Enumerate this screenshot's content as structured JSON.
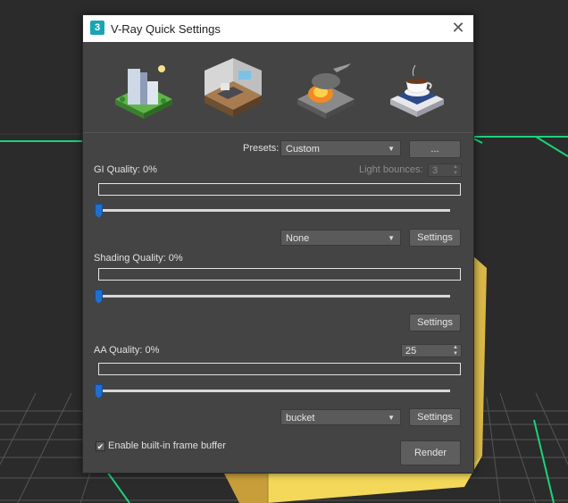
{
  "window": {
    "title": "V-Ray Quick Settings",
    "app_icon_label": "3",
    "close_glyph": "✕"
  },
  "presets_row": {
    "icons": [
      "exterior-preset-icon",
      "interior-preset-icon",
      "fx-preset-icon",
      "product-preset-icon"
    ],
    "label": "Presets:",
    "selected": "Custom",
    "more_label": "..."
  },
  "gi": {
    "label": "GI Quality: 0%",
    "value_percent": 0,
    "light_bounces_label": "Light bounces:",
    "light_bounces_value": "3",
    "engine_selected": "None",
    "settings_label": "Settings"
  },
  "shading": {
    "label": "Shading Quality: 0%",
    "value_percent": 0,
    "settings_label": "Settings"
  },
  "aa": {
    "label": "AA Quality: 0%",
    "value_percent": 0,
    "spinner_value": "25",
    "sampler_selected": "bucket",
    "settings_label": "Settings"
  },
  "footer": {
    "vfb_checkbox_checked": true,
    "vfb_checkbox_glyph": "✔",
    "vfb_label": "Enable built-in frame buffer",
    "render_label": "Render"
  },
  "colors": {
    "dialog_bg": "#444444",
    "accent_blue": "#1f6fd1",
    "viewport_grid": "#5a5a5a",
    "viewport_green": "#1ad37a",
    "box_yellow": "#f3d85a"
  }
}
